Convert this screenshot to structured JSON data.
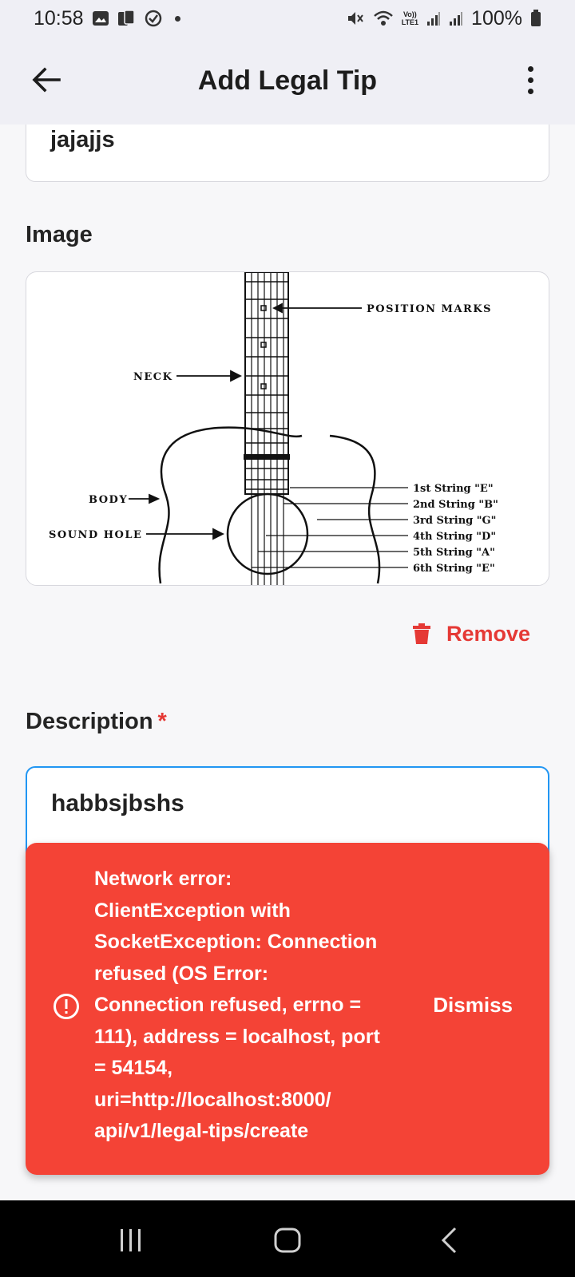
{
  "status_bar": {
    "time": "10:58",
    "battery": "100%",
    "network_label_top": "Vo))",
    "network_label_bottom": "LTE1"
  },
  "app_bar": {
    "title": "Add Legal Tip"
  },
  "form": {
    "title_value": "jajajjs",
    "image_label": "Image",
    "remove_label": "Remove",
    "description_label": "Description",
    "description_required_marker": "*",
    "description_value": "habbsjbshs"
  },
  "diagram": {
    "position_marks": "POSITION MARKS",
    "neck": "NECK",
    "body": "BODY",
    "sound_hole": "SOUND HOLE",
    "strings": [
      "1st String \"E\"",
      "2nd String \"B\"",
      "3rd String \"G\"",
      "4th String \"D\"",
      "5th String \"A\"",
      "6th String \"E\""
    ]
  },
  "snackbar": {
    "message": "Network error: ClientException with SocketException: Connection refused (OS Error: Connection refused, errno = 111), address = localhost, port = 54154, uri=http://localhost:8000/ api/v1/legal-tips/create",
    "action": "Dismiss"
  },
  "colors": {
    "accent_blue": "#2196f3",
    "error_red": "#f44336",
    "remove_red": "#e53935",
    "app_bar_bg": "#efeff5"
  },
  "icons": {
    "back": "arrow-left-icon",
    "more": "more-vert-icon",
    "remove": "trash-icon",
    "error": "error-outline-icon"
  }
}
